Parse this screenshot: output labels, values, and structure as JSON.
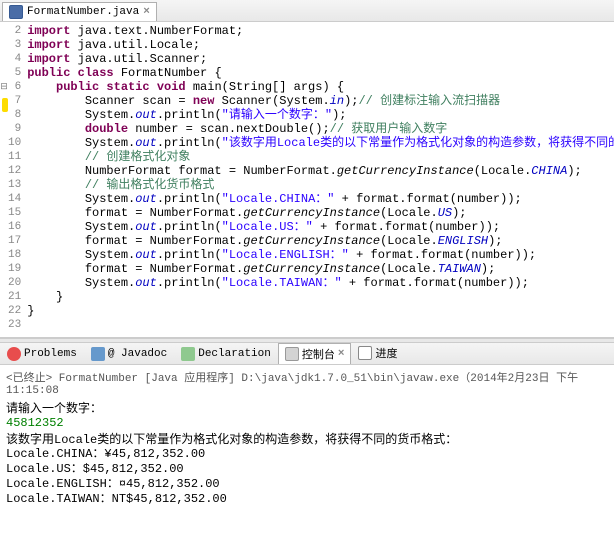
{
  "editor": {
    "tab": {
      "filename": "FormatNumber.java"
    },
    "lines": [
      {
        "n": 2,
        "m": "",
        "html": "<span class='kw'>import</span> java.text.NumberFormat;"
      },
      {
        "n": 3,
        "m": "",
        "html": "<span class='kw'>import</span> java.util.Locale;"
      },
      {
        "n": 4,
        "m": "",
        "html": "<span class='kw'>import</span> java.util.Scanner;"
      },
      {
        "n": 5,
        "m": "",
        "html": "<span class='kw'>public class</span> FormatNumber {"
      },
      {
        "n": 6,
        "m": "minus",
        "html": "    <span class='kw'>public static void</span> main(String[] args) {"
      },
      {
        "n": 7,
        "m": "yellow",
        "html": "        Scanner scan = <span class='kw'>new</span> Scanner(System.<span class='fld'>in</span>);<span class='com'>// 创建标注输入流扫描器</span>"
      },
      {
        "n": 8,
        "m": "",
        "html": "        System.<span class='fld'>out</span>.println(<span class='str'>\"请输入一个数字：\"</span>);"
      },
      {
        "n": 9,
        "m": "",
        "html": "        <span class='kw'>double</span> number = scan.nextDouble();<span class='com'>// 获取用户输入数字</span>"
      },
      {
        "n": 10,
        "m": "",
        "html": "        System.<span class='fld'>out</span>.println(<span class='str'>\"该数字用Locale类的以下常量作为格式化对象的构造参数，将获得不同的货币格式：\"</span>);"
      },
      {
        "n": 11,
        "m": "",
        "html": "        <span class='com'>// 创建格式化对象</span>"
      },
      {
        "n": 12,
        "m": "",
        "html": "        NumberFormat format = NumberFormat.<span class='sti'>getCurrencyInstance</span>(Locale.<span class='fld'>CHINA</span>);"
      },
      {
        "n": 13,
        "m": "",
        "html": "        <span class='com'>// 输出格式化货币格式</span>"
      },
      {
        "n": 14,
        "m": "",
        "html": "        System.<span class='fld'>out</span>.println(<span class='str'>\"Locale.CHINA：\"</span> + format.format(number));"
      },
      {
        "n": 15,
        "m": "",
        "html": "        format = NumberFormat.<span class='sti'>getCurrencyInstance</span>(Locale.<span class='fld'>US</span>);"
      },
      {
        "n": 16,
        "m": "",
        "html": "        System.<span class='fld'>out</span>.println(<span class='str'>\"Locale.US：\"</span> + format.format(number));"
      },
      {
        "n": 17,
        "m": "",
        "html": "        format = NumberFormat.<span class='sti'>getCurrencyInstance</span>(Locale.<span class='fld'>ENGLISH</span>);"
      },
      {
        "n": 18,
        "m": "",
        "html": "        System.<span class='fld'>out</span>.println(<span class='str'>\"Locale.ENGLISH：\"</span> + format.format(number));"
      },
      {
        "n": 19,
        "m": "",
        "html": "        format = NumberFormat.<span class='sti'>getCurrencyInstance</span>(Locale.<span class='fld'>TAIWAN</span>);"
      },
      {
        "n": 20,
        "m": "",
        "html": "        System.<span class='fld'>out</span>.println(<span class='str'>\"Locale.TAIWAN：\"</span> + format.format(number));"
      },
      {
        "n": 21,
        "m": "",
        "html": "    }"
      },
      {
        "n": 22,
        "m": "",
        "html": "}"
      },
      {
        "n": 23,
        "m": "",
        "html": ""
      }
    ]
  },
  "console_tabs": {
    "problems": "Problems",
    "javadoc": "@ Javadoc",
    "declaration": "Declaration",
    "console": "控制台",
    "progress": "进度"
  },
  "console": {
    "header": "<已终止> FormatNumber [Java 应用程序] D:\\java\\jdk1.7.0_51\\bin\\javaw.exe（2014年2月23日 下午11:15:08",
    "lines": [
      {
        "t": "请输入一个数字：",
        "cls": "comcn"
      },
      {
        "t": "45812352",
        "cls": "num"
      },
      {
        "t": "该数字用Locale类的以下常量作为格式化对象的构造参数，将获得不同的货币格式：",
        "cls": "comcn"
      },
      {
        "t": "Locale.CHINA：¥45,812,352.00",
        "cls": "out"
      },
      {
        "t": "Locale.US：$45,812,352.00",
        "cls": "out"
      },
      {
        "t": "Locale.ENGLISH：¤45,812,352.00",
        "cls": "out"
      },
      {
        "t": "Locale.TAIWAN：NT$45,812,352.00",
        "cls": "out"
      }
    ]
  }
}
